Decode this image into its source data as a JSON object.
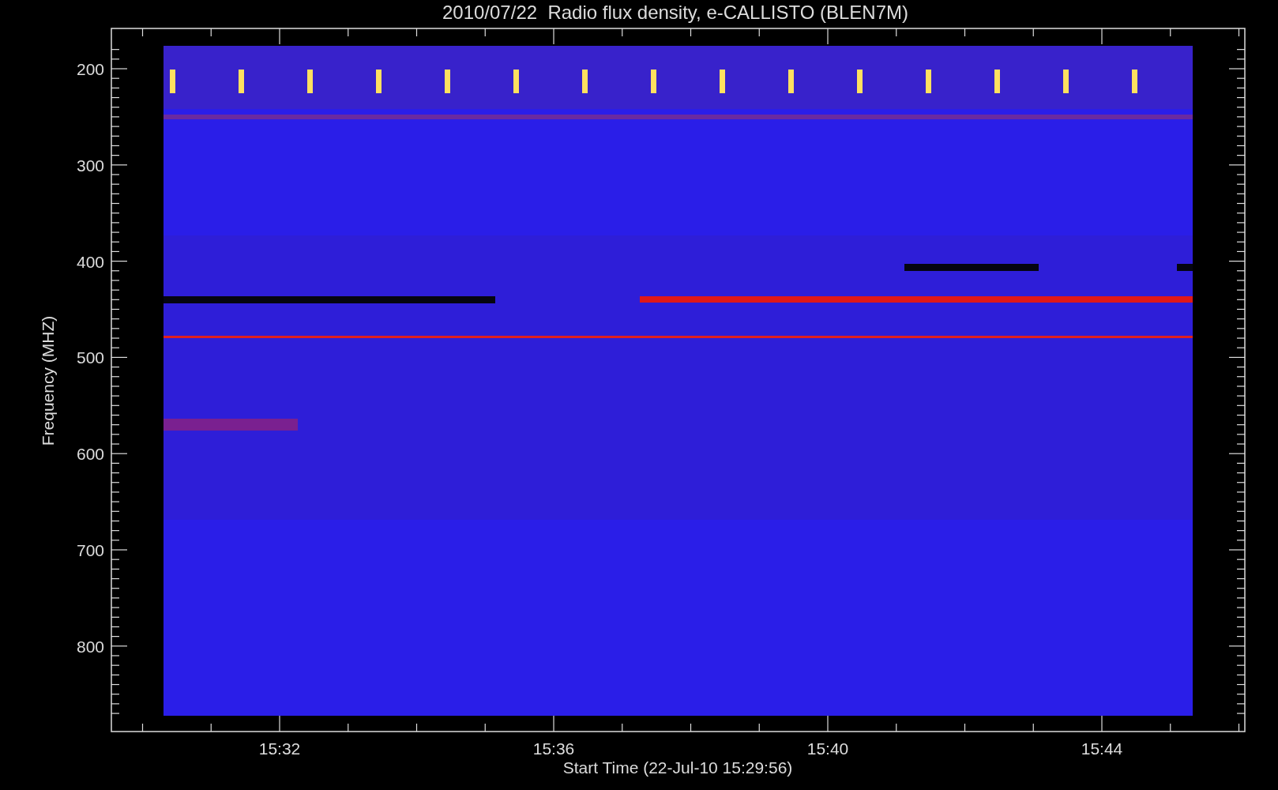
{
  "title": "2010/07/22  Radio flux density, e-CALLISTO (BLEN7M)",
  "y_axis": {
    "label": "Frequency (MHZ)",
    "ticks": [
      "200",
      "300",
      "400",
      "500",
      "600",
      "700",
      "800"
    ]
  },
  "x_axis": {
    "label": "Start Time (22-Jul-10 15:29:56)",
    "ticks": [
      "15:32",
      "15:36",
      "15:40",
      "15:44"
    ]
  }
}
